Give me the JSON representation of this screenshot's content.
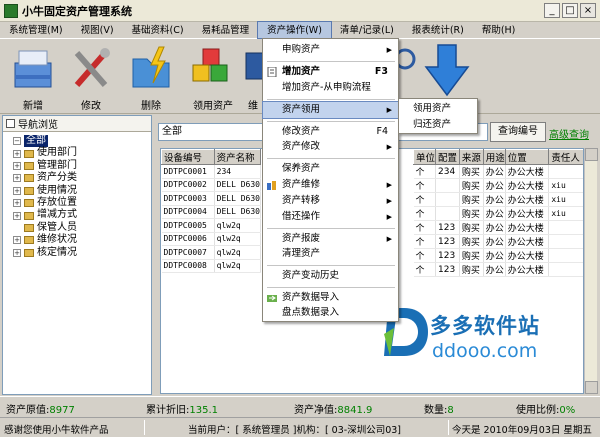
{
  "window": {
    "title": "小牛固定资产管理系统",
    "buttons": [
      "_",
      "□",
      "×"
    ]
  },
  "menubar": {
    "items": [
      "系统管理(M)",
      "视图(V)",
      "基础资料(C)",
      "易耗品管理",
      "资产操作(W)",
      "清单/记录(L)",
      "报表统计(R)",
      "帮助(H)"
    ],
    "active_index": 4
  },
  "toolbar": {
    "items": [
      "新增",
      "修改",
      "删除",
      "领用资产",
      "维"
    ]
  },
  "nav": {
    "title": "导航浏览",
    "root": "全部",
    "nodes": [
      "使用部门",
      "管理部门",
      "资产分类",
      "使用情况",
      "存放位置",
      "增减方式",
      "保管人员",
      "维修状况",
      "核定情况"
    ]
  },
  "filter": {
    "value": "全部"
  },
  "query_button": "查询编号",
  "advanced_link": "高级查询",
  "grid": {
    "left_columns": [
      "设备编号",
      "资产名称"
    ],
    "right_columns": [
      "单位",
      "配置",
      "来源",
      "用途",
      "位置",
      "责任人"
    ],
    "rows": [
      {
        "id": "DDTPC0001",
        "name": "234",
        "unit": "个",
        "conf": "234",
        "src": "购买",
        "use": "办公",
        "loc": "办公大楼",
        "owner": ""
      },
      {
        "id": "DDTPC0002",
        "name": "DELL D630",
        "unit": "个",
        "conf": "",
        "src": "购买",
        "use": "办公",
        "loc": "办公大楼",
        "owner": "xiu"
      },
      {
        "id": "DDTPC0003",
        "name": "DELL D630",
        "unit": "个",
        "conf": "",
        "src": "购买",
        "use": "办公",
        "loc": "办公大楼",
        "owner": "xiu"
      },
      {
        "id": "DDTPC0004",
        "name": "DELL D630",
        "unit": "个",
        "conf": "",
        "src": "购买",
        "use": "办公",
        "loc": "办公大楼",
        "owner": "xiu"
      },
      {
        "id": "DDTPC0005",
        "name": "qlw2q",
        "unit": "个",
        "conf": "123",
        "src": "购买",
        "use": "办公",
        "loc": "办公大楼",
        "owner": ""
      },
      {
        "id": "DDTPC0006",
        "name": "qlw2q",
        "unit": "个",
        "conf": "123",
        "src": "购买",
        "use": "办公",
        "loc": "办公大楼",
        "owner": ""
      },
      {
        "id": "DDTPC0007",
        "name": "qlw2q",
        "unit": "个",
        "conf": "123",
        "src": "购买",
        "use": "办公",
        "loc": "办公大楼",
        "owner": ""
      },
      {
        "id": "DDTPC0008",
        "name": "qlw2q",
        "unit": "个",
        "conf": "123",
        "src": "购买",
        "use": "办公",
        "loc": "办公大楼",
        "owner": ""
      }
    ]
  },
  "dropdown": {
    "items": [
      {
        "label": "申购资产",
        "arrow": true
      },
      {
        "label": "增加资产",
        "shortcut": "F3",
        "bold": true,
        "icon": "doc-icon"
      },
      {
        "label": "增加资产-从申购流程"
      },
      {
        "label": "资产领用",
        "arrow": true,
        "highlight": true
      },
      {
        "label": "修改资产",
        "shortcut": "F4"
      },
      {
        "label": "资产修改",
        "arrow": true
      },
      {
        "label": "保养资产"
      },
      {
        "label": "资产维修",
        "arrow": true,
        "icon": "repair-icon"
      },
      {
        "label": "资产转移",
        "arrow": true
      },
      {
        "label": "借还操作",
        "arrow": true
      },
      {
        "label": "资产报废",
        "arrow": true
      },
      {
        "label": "清理资产"
      },
      {
        "label": "资产变动历史"
      },
      {
        "label": "资产数据导入",
        "icon": "import-icon"
      },
      {
        "label": "盘点数据录入"
      }
    ]
  },
  "submenu": {
    "items": [
      "领用资产",
      "归还资产"
    ]
  },
  "status1": {
    "orig_label": "资产原值:",
    "orig_value": "8977",
    "dep_label": "累计折旧:",
    "dep_value": "135.1",
    "net_label": "资产净值:",
    "net_value": "8841.9",
    "qty_label": "数量:",
    "qty_value": "8",
    "ratio_label": "使用比例:",
    "ratio_value": "0%"
  },
  "status2": {
    "thanks": "感谢您使用小牛软件产品",
    "user": "当前用户：[ 系统管理员 ]机构：[ 03-深圳公司03]",
    "date": "今天是  2010年09月03日  星期五"
  },
  "watermark": {
    "line1": "多多软件站",
    "line2": "ddooo.com"
  },
  "colors": {
    "accent_green": "#008000",
    "menu_highlight": "#c2d3ed",
    "selection": "#0a246a"
  }
}
